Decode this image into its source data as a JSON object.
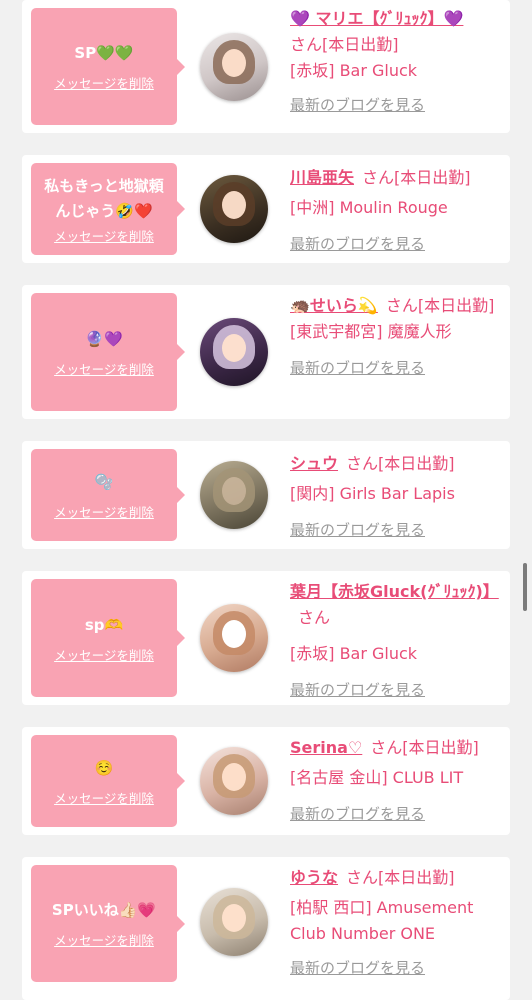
{
  "labels": {
    "delete": "メッセージを削除",
    "blog": "最新のブログを見る",
    "san": "さん",
    "today": "[本日出勤]"
  },
  "items": [
    {
      "message": "SP💚💚",
      "name": "💜 マリエ【ｸﾞﾘｭｯｸ】💜",
      "status": "さん[本日出勤]",
      "location": "[赤坂] Bar Gluck"
    },
    {
      "message": "私もきっと地獄頼んじゃう🤣❤️",
      "name": "川島亜矢",
      "status": "さん[本日出勤]",
      "location": "[中洲] Moulin Rouge"
    },
    {
      "message": "🔮💜",
      "name": "🦔せいら💫",
      "status": "さん[本日出勤]",
      "location": "[東武宇都宮] 魔魔人形"
    },
    {
      "message": "🫧",
      "name": "シュウ",
      "status": "さん[本日出勤]",
      "location": "[関内] Girls Bar Lapis"
    },
    {
      "message": "sp🫶",
      "name": "葉月【赤坂Gluck(ｸﾞﾘｭｯｸ)】",
      "status": "さん",
      "location": "[赤坂] Bar Gluck"
    },
    {
      "message": "☺️",
      "name": "Serina♡",
      "status": "さん[本日出勤]",
      "location": "[名古屋 金山] CLUB LIT"
    },
    {
      "message": "SPいいね👍🏻💗",
      "name": "ゆうな",
      "status": "さん[本日出勤]",
      "location": "[柏駅 西口] Amusement Club Number ONE"
    }
  ],
  "colors": {
    "accent": "#e84c77",
    "bubble": "#f9a3b3",
    "background": "#f1f1f1",
    "blog_link": "#9a9a9a"
  }
}
